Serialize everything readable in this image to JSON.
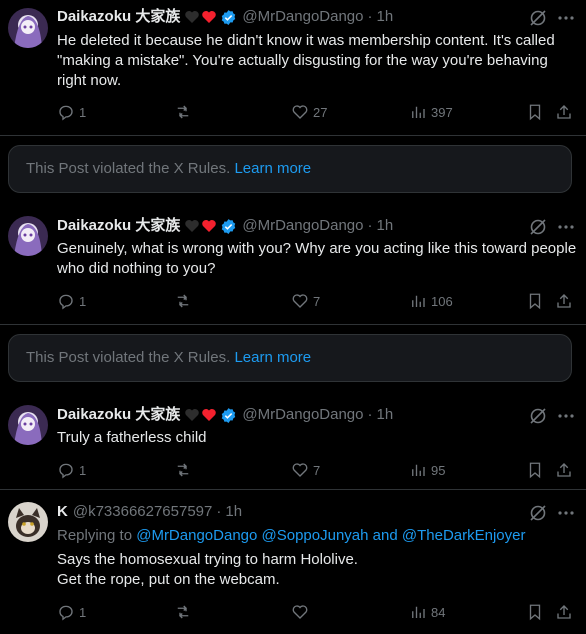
{
  "posts": [
    {
      "name": "Daikazoku 大家族",
      "handle": "@MrDangoDango",
      "time": "1h",
      "text": "He deleted it because he didn't know it was membership content. It's called \"making a mistake\". You're actually disgusting for the way you're behaving right now.",
      "replies": "1",
      "likes": "27",
      "views": "397"
    },
    {
      "name": "Daikazoku 大家族",
      "handle": "@MrDangoDango",
      "time": "1h",
      "text": "Genuinely, what is wrong with you? Why are you acting like this toward people who did nothing to you?",
      "replies": "1",
      "likes": "7",
      "views": "106"
    },
    {
      "name": "Daikazoku 大家族",
      "handle": "@MrDangoDango",
      "time": "1h",
      "text": "Truly a fatherless child",
      "replies": "1",
      "likes": "7",
      "views": "95"
    },
    {
      "name": "K",
      "handle": "@k73366627657597",
      "time": "1h",
      "replying_label": "Replying to",
      "reply_mentions": [
        "@MrDangoDango",
        "@SoppoJunyah",
        "and",
        "@TheDarkEnjoyer"
      ],
      "text": "Says the homosexual trying to harm Hololive.\nGet the rope, put on the webcam.",
      "replies": "1",
      "likes": "",
      "views": "84"
    }
  ],
  "notices": [
    {
      "text": "This Post violated the X Rules. ",
      "link": "Learn more"
    },
    {
      "text": "This Post violated the X Rules. ",
      "link": "Learn more"
    }
  ],
  "dot": "·",
  "colors": {
    "background": "#000000",
    "text": "#e7e9ea",
    "muted": "#71767b",
    "link": "#1d9bf0",
    "heart": "#f4212e"
  }
}
